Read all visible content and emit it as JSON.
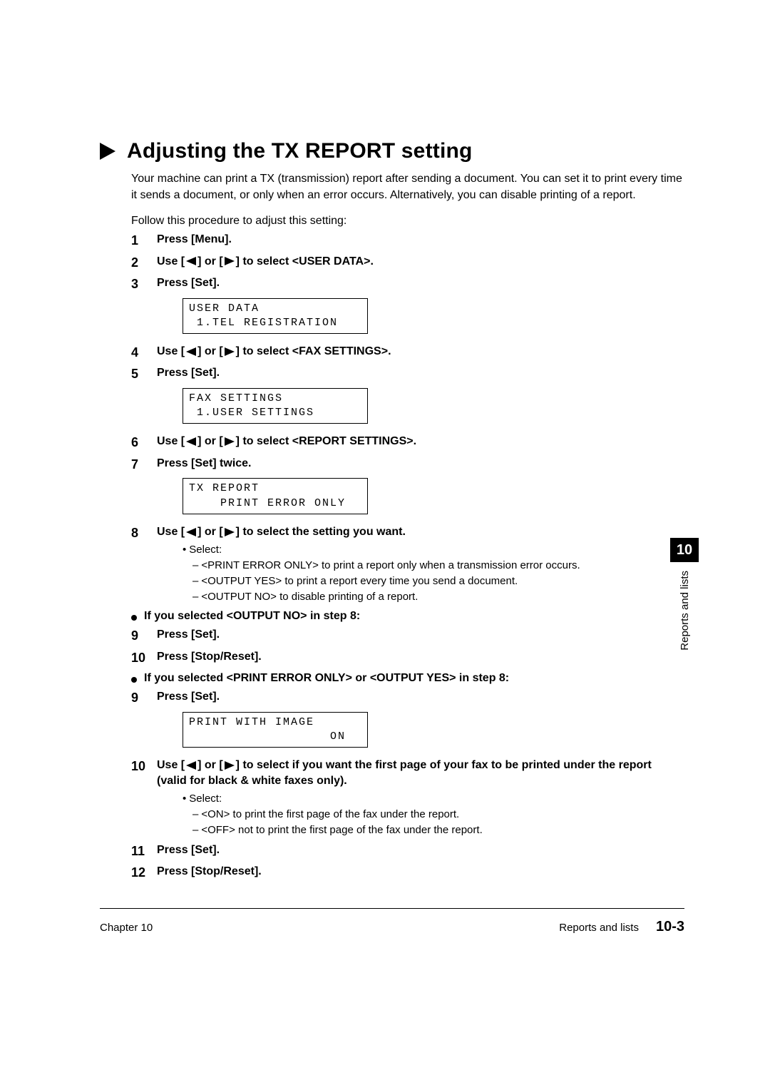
{
  "heading": "Adjusting the TX REPORT setting",
  "intro": "Your machine can print a TX (transmission) report after sending a document. You can set it to print every time it sends a document, or only when an error occurs. Alternatively, you can disable printing of a report.",
  "intro2": "Follow this procedure to adjust this setting:",
  "steps": {
    "s1": {
      "num": "1",
      "text": "Press [Menu]."
    },
    "s2": {
      "num": "2",
      "pre": "Use [",
      "mid": "] or [",
      "post": "] to select <USER DATA>."
    },
    "s3": {
      "num": "3",
      "text": "Press [Set]."
    },
    "lcd1_l1": "USER DATA",
    "lcd1_l2": " 1.TEL REGISTRATION",
    "s4": {
      "num": "4",
      "pre": "Use [",
      "mid": "] or [",
      "post": "] to select <FAX SETTINGS>."
    },
    "s5": {
      "num": "5",
      "text": "Press [Set]."
    },
    "lcd2_l1": "FAX SETTINGS",
    "lcd2_l2": " 1.USER SETTINGS",
    "s6": {
      "num": "6",
      "pre": "Use [",
      "mid": "] or [",
      "post": "] to select <REPORT SETTINGS>."
    },
    "s7": {
      "num": "7",
      "text": "Press [Set] twice."
    },
    "lcd3_l1": "TX REPORT",
    "lcd3_l2": "    PRINT ERROR ONLY",
    "s8": {
      "num": "8",
      "pre": "Use [",
      "mid": "] or [",
      "post": "] to select the setting you want."
    },
    "s8_select": "Select:",
    "s8_opt1": "<PRINT ERROR ONLY> to print a report only when a transmission error occurs.",
    "s8_opt2": "<OUTPUT YES> to print a report every time you send a document.",
    "s8_opt3": "<OUTPUT NO> to disable printing of a report.",
    "branch1": "If you selected <OUTPUT NO> in step 8:",
    "s9a": {
      "num": "9",
      "text": "Press [Set]."
    },
    "s10a": {
      "num": "10",
      "text": "Press [Stop/Reset]."
    },
    "branch2": "If you selected <PRINT ERROR ONLY> or <OUTPUT YES> in step 8:",
    "s9b": {
      "num": "9",
      "text": "Press [Set]."
    },
    "lcd4_l1": "PRINT WITH IMAGE",
    "lcd4_l2": "                  ON",
    "s10b": {
      "num": "10",
      "pre": "Use [",
      "mid": "] or [",
      "post": "] to select if you want the first page of your fax to be printed under the report (valid for black & white faxes only)."
    },
    "s10b_select": "Select:",
    "s10b_opt1": "<ON> to print the first page of the fax under the report.",
    "s10b_opt2": "<OFF> not to print the first page of the fax under the report.",
    "s11": {
      "num": "11",
      "text": "Press [Set]."
    },
    "s12": {
      "num": "12",
      "text": "Press [Stop/Reset]."
    }
  },
  "sideTab": {
    "num": "10",
    "label": "Reports and lists"
  },
  "footer": {
    "left": "Chapter 10",
    "rightLabel": "Reports and lists",
    "pageNum": "10-3"
  }
}
